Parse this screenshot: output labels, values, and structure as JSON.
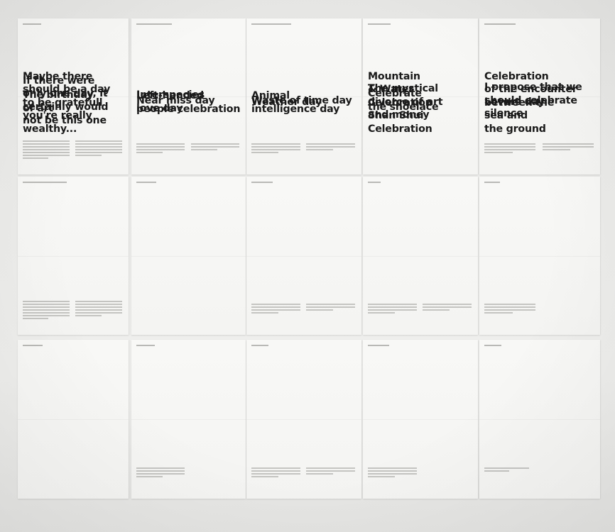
{
  "posters": [
    {
      "id": "birthday-of-art",
      "row": 0,
      "col": 0,
      "title": "The birthday\nof art",
      "lines": 2,
      "fine": "two-col-long"
    },
    {
      "id": "interspecies-love-day",
      "row": 0,
      "col": 1,
      "title": "Interspecies\nlove day",
      "lines": 2,
      "fine": "two-col-short"
    },
    {
      "id": "weather-day",
      "row": 0,
      "col": 2,
      "title": "Weather day",
      "lines": 1,
      "fine": "two-col-short"
    },
    {
      "id": "mystical-divorce",
      "row": 0,
      "col": 3,
      "title": "The mystical\ndivorce of art\nand money",
      "lines": 3,
      "fine": "none"
    },
    {
      "id": "lovers-day",
      "row": 0,
      "col": 4,
      "title": "Lovers day",
      "lines": 1,
      "fine": "two-col-short"
    },
    {
      "id": "grateful-day",
      "row": 1,
      "col": 0,
      "title": "Maybe there\nshould be a day\nto be gratefull\nyou're really\nwealthy...",
      "lines": 5,
      "fine": "two-col-long"
    },
    {
      "id": "left-handed",
      "row": 1,
      "col": 1,
      "title": "Left-handed\npeople celebration",
      "lines": 2,
      "fine": "none"
    },
    {
      "id": "animal-intelligence",
      "row": 1,
      "col": 2,
      "title": "Animal\nintelligence day",
      "lines": 2,
      "fine": "two-col-short"
    },
    {
      "id": "shan-shui",
      "row": 1,
      "col": 3,
      "title": "Mountain\n& Water\nCelebration\nShan Shui\nCelebration",
      "lines": 5,
      "fine": "two-col-short"
    },
    {
      "id": "sea-and-ground",
      "row": 1,
      "col": 4,
      "title": "Celebration\nof the encounter\nbetween the\nsea and\nthe ground",
      "lines": 5,
      "fine": "one-col"
    },
    {
      "id": "only-one-day",
      "row": 2,
      "col": 0,
      "title": "If there were\nonly one day, it\ncertainly would\nnot be this one",
      "lines": 4,
      "fine": "none"
    },
    {
      "id": "near-miss-day",
      "row": 2,
      "col": 1,
      "title": "Near miss day",
      "lines": 1,
      "fine": "one-col"
    },
    {
      "id": "waste-of-time",
      "row": 2,
      "col": 2,
      "title": "Waste of time day",
      "lines": 1,
      "fine": "two-col-short"
    },
    {
      "id": "shoelace",
      "row": 2,
      "col": 3,
      "title": "Celebrate\nthe shoelace",
      "lines": 2,
      "fine": "one-col"
    },
    {
      "id": "silence",
      "row": 2,
      "col": 4,
      "title": "I propose that we\nshould celebrate\nsilence",
      "lines": 3,
      "fine": "one-thin"
    }
  ]
}
